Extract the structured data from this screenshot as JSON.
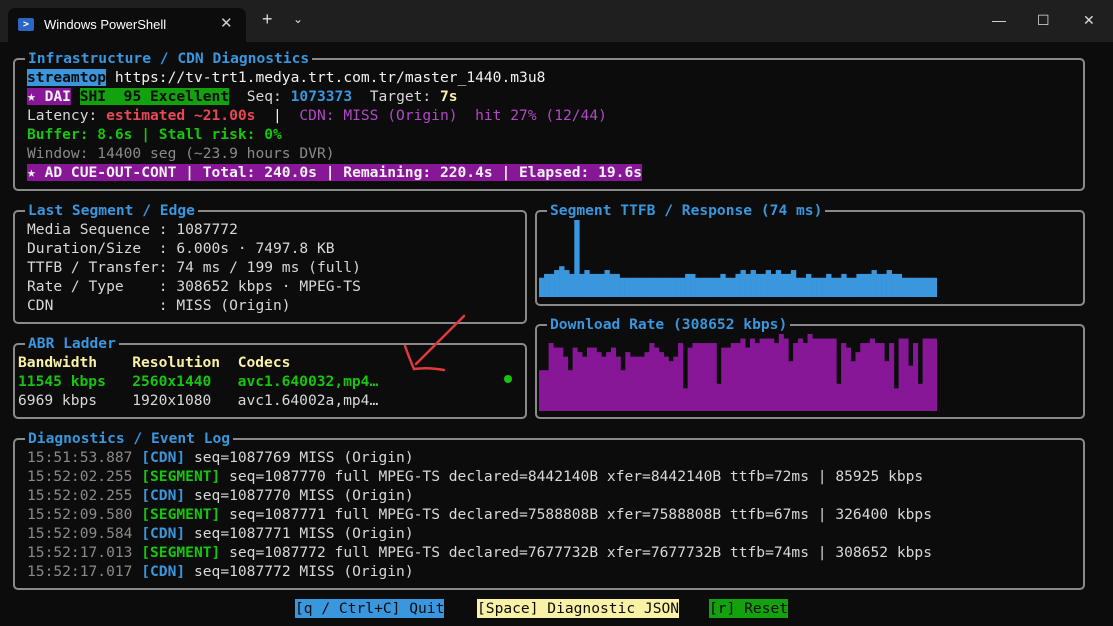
{
  "window": {
    "title": "Windows PowerShell",
    "tab_icon": "powershell-icon",
    "new_tab_symbol": "+",
    "dropdown_symbol": "⌄",
    "close_tab_symbol": "✕",
    "minimize_symbol": "—",
    "maximize_symbol": "☐",
    "close_symbol": "✕"
  },
  "infra": {
    "title": "Infrastructure / CDN Diagnostics",
    "badge": "streamtop",
    "url": "https://tv-trt1.medya.trt.com.tr/master_1440.m3u8",
    "dai_badge": "★ DAI",
    "shi_badge": "SHI  95 Excellent",
    "seq_label": "Seq: ",
    "seq_value": "1073373",
    "target_label": "Target: ",
    "target_value": "7s",
    "latency_label": "Latency: ",
    "latency_value": "estimated ~21.00s",
    "separator": "  |  ",
    "cdn_status": "CDN: MISS (Origin)  hit 27% (12/44)",
    "buffer_line": "Buffer: 8.6s | Stall risk: 0%",
    "window_line": "Window: 14400 seg (~23.9 hours DVR)",
    "ad_line": "★ AD CUE-OUT-CONT | Total: 240.0s | Remaining: 220.4s | Elapsed: 19.6s"
  },
  "segment": {
    "title": "Last Segment / Edge",
    "rows": [
      "Media Sequence : 1087772",
      "Duration/Size  : 6.000s · 7497.8 KB",
      "TTFB / Transfer: 74 ms / 199 ms (full)",
      "Rate / Type    : 308652 kbps · MPEG-TS",
      "CDN            : MISS (Origin)"
    ]
  },
  "abr": {
    "title": "ABR Ladder",
    "headers": {
      "bandwidth": "Bandwidth",
      "resolution": "Resolution",
      "codecs": "Codecs"
    },
    "rows": [
      {
        "bandwidth": "11545 kbps",
        "resolution": "2560x1440",
        "codecs": "avc1.640032,mp4…",
        "active": true
      },
      {
        "bandwidth": "6969 kbps",
        "resolution": "1920x1080",
        "codecs": "avc1.64002a,mp4…",
        "active": false
      }
    ]
  },
  "log": {
    "title": "Diagnostics / Event Log",
    "entries": [
      {
        "time": "15:51:53.887",
        "tag": "[CDN]",
        "msg": "seq=1087769 MISS (Origin)"
      },
      {
        "time": "15:52:02.255",
        "tag": "[SEGMENT]",
        "msg": "seq=1087770 full MPEG-TS declared=8442140B xfer=8442140B ttfb=72ms | 85925 kbps"
      },
      {
        "time": "15:52:02.255",
        "tag": "[CDN]",
        "msg": "seq=1087770 MISS (Origin)"
      },
      {
        "time": "15:52:09.580",
        "tag": "[SEGMENT]",
        "msg": "seq=1087771 full MPEG-TS declared=7588808B xfer=7588808B ttfb=67ms | 326400 kbps"
      },
      {
        "time": "15:52:09.584",
        "tag": "[CDN]",
        "msg": "seq=1087771 MISS (Origin)"
      },
      {
        "time": "15:52:17.013",
        "tag": "[SEGMENT]",
        "msg": "seq=1087772 full MPEG-TS declared=7677732B xfer=7677732B ttfb=74ms | 308652 kbps"
      },
      {
        "time": "15:52:17.017",
        "tag": "[CDN]",
        "msg": "seq=1087772 MISS (Origin)"
      }
    ]
  },
  "footer": {
    "quit": "[q / Ctrl+C] Quit",
    "json": "[Space] Diagnostic JSON",
    "reset": "[r] Reset"
  },
  "colors": {
    "ttfb": "#3a96dd",
    "download": "#881798"
  },
  "chart_data": [
    {
      "type": "bar",
      "title": "Segment TTFB / Response (74 ms)",
      "values": [
        5,
        6,
        6,
        7,
        8,
        7,
        6,
        20,
        6,
        7,
        6,
        6,
        6,
        7,
        6,
        6,
        5,
        5,
        5,
        5,
        5,
        5,
        5,
        5,
        5,
        5,
        5,
        5,
        5,
        6,
        6,
        5,
        5,
        5,
        5,
        5,
        6,
        5,
        5,
        6,
        7,
        6,
        7,
        6,
        6,
        7,
        6,
        7,
        6,
        6,
        7,
        5,
        5,
        6,
        5,
        5,
        5,
        6,
        5,
        5,
        6,
        5,
        5,
        6,
        6,
        6,
        7,
        6,
        6,
        7,
        6,
        6,
        5,
        5,
        5,
        5,
        5,
        5,
        5
      ],
      "ylim": [
        0,
        20
      ]
    },
    {
      "type": "bar",
      "title": "Download Rate (308652 kbps)",
      "values": [
        9,
        9,
        15,
        14,
        14,
        12,
        9,
        14,
        13,
        12,
        14,
        14,
        13,
        12,
        13,
        14,
        12,
        9,
        13,
        12,
        12,
        12,
        13,
        15,
        14,
        13,
        12,
        11,
        12,
        15,
        5,
        14,
        15,
        15,
        15,
        15,
        15,
        6,
        14,
        14,
        15,
        15,
        16,
        14,
        16,
        15,
        16,
        16,
        16,
        15,
        17,
        16,
        11,
        15,
        16,
        15,
        17,
        16,
        16,
        16,
        16,
        16,
        6,
        15,
        14,
        11,
        13,
        15,
        15,
        16,
        15,
        15,
        11,
        15,
        5,
        16,
        16,
        10,
        15,
        6,
        16,
        16,
        16
      ],
      "ylim": [
        0,
        17
      ]
    }
  ]
}
